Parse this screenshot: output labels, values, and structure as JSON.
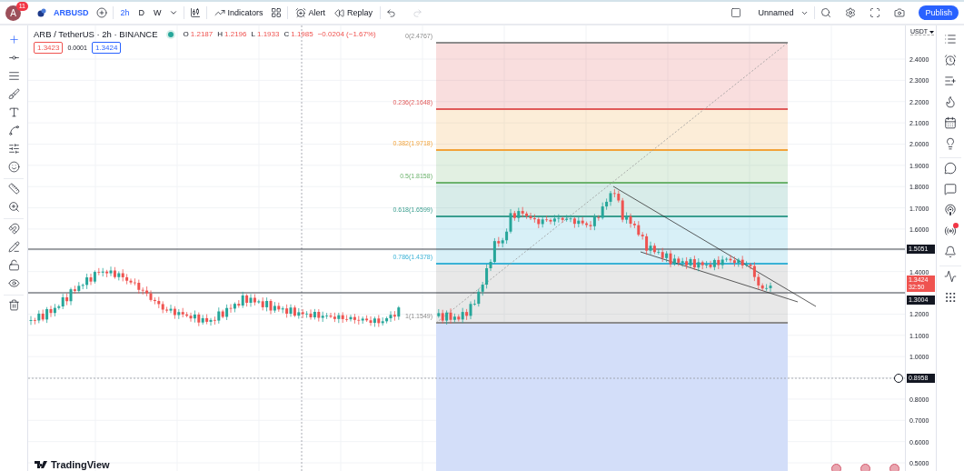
{
  "header": {
    "avatar": "A",
    "notifications": "11",
    "symbol": "ARBUSD",
    "intervals": [
      {
        "label": "2h",
        "selected": true
      },
      {
        "label": "D",
        "selected": false
      },
      {
        "label": "W",
        "selected": false
      }
    ],
    "indicators": "Indicators",
    "alert": "Alert",
    "replay": "Replay",
    "undo": {
      "disabled": false
    },
    "redo": {
      "disabled": true
    },
    "layout_name": "Unnamed",
    "publish": "Publish"
  },
  "legend": {
    "title": "ARB / TetherUS · 2h · BINANCE",
    "market_open": true,
    "ohlc": [
      {
        "key": "O",
        "value": "1.2187"
      },
      {
        "key": "H",
        "value": "1.2196"
      },
      {
        "key": "L",
        "value": "1.1933"
      },
      {
        "key": "C",
        "value": "1.1985"
      }
    ],
    "change": "−0.0204 (−1.67%)",
    "sell": "1.3423",
    "spread": "0.0001",
    "buy": "1.3424"
  },
  "tool_groups": [
    {
      "tools": [
        {
          "selected": true
        },
        {
          "selected": false
        },
        {
          "selected": false
        },
        {
          "selected": false
        },
        {
          "selected": false
        },
        {
          "selected": false
        },
        {
          "selected": false
        },
        {
          "selected": false
        }
      ]
    },
    {
      "tools": [
        {
          "selected": false
        },
        {
          "selected": false
        }
      ]
    },
    {
      "tools": [
        {
          "selected": false
        },
        {
          "selected": false
        },
        {
          "selected": false
        },
        {
          "selected": false
        }
      ]
    },
    {
      "tools": [
        {
          "selected": false
        }
      ]
    }
  ],
  "fib_levels": [
    {
      "label": "0(2.4767)",
      "color": "#8c8c8c"
    },
    {
      "label": "0.236(2.1648)",
      "color": "#e05a5a"
    },
    {
      "label": "0.382(1.9718)",
      "color": "#f2a33a"
    },
    {
      "label": "0.5(1.8158)",
      "color": "#6db36d"
    },
    {
      "label": "0.618(1.6599)",
      "color": "#3a9e8f"
    },
    {
      "label": "0.786(1.4378)",
      "color": "#3ab2d6"
    },
    {
      "label": "1(1.1549)",
      "color": "#8c8c8c"
    }
  ],
  "price_axis": {
    "currency": "USDT",
    "ticks": [
      "2.4000",
      "2.3000",
      "2.2000",
      "2.1000",
      "2.0000",
      "1.9000",
      "1.8000",
      "1.7000",
      "1.6000",
      "1.4000",
      "1.2000",
      "1.1000",
      "1.0000",
      "0.8000",
      "0.7000",
      "0.6000",
      "0.5000"
    ],
    "tags": [
      {
        "kind": "line",
        "label": "1.5051"
      },
      {
        "kind": "last",
        "label": "1.3424",
        "countdown": "32:50"
      },
      {
        "kind": "line",
        "label": "1.3004"
      },
      {
        "kind": "cursor",
        "label": "0.8958"
      }
    ]
  },
  "sidebar": [
    {
      "notification": false
    },
    {
      "notification": false
    },
    {
      "notification": false
    },
    {
      "notification": false
    },
    {
      "notification": false
    },
    {
      "notification": false
    },
    {
      "notification": false
    },
    {
      "notification": false
    },
    {
      "notification": false
    },
    {
      "notification": true
    },
    {
      "notification": false
    },
    {
      "notification": false
    },
    {
      "notification": false
    }
  ],
  "brand": "TradingView"
}
